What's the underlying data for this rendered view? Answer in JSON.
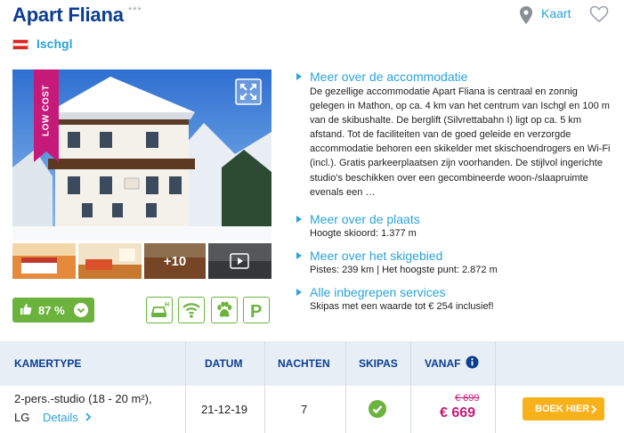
{
  "header": {
    "title": "Apart Fliana",
    "stars": "***",
    "location": "Ischgl",
    "map_label": "Kaart"
  },
  "gallery": {
    "badge": "LOW COST",
    "more_photos": "+10"
  },
  "rating": {
    "value": "87 %",
    "color": "#6cb33e"
  },
  "facility_icons": [
    "parking-garage-icon",
    "wifi-icon",
    "pets-icon",
    "parking-icon"
  ],
  "info": {
    "accommodation": {
      "heading": "Meer over de accommodatie",
      "text": "De gezellige accommodatie Apart Fliana is centraal en zonnig gelegen in Mathon, op ca. 4 km van het centrum van Ischgl en 100 m van de skibushalte. De berglift (Silvrettabahn I) ligt op ca. 5 km afstand. Tot de faciliteiten van de goed geleide en verzorgde accommodatie behoren een skikelder met skischoendrogers en Wi-Fi (incl.). Gratis parkeerplaatsen zijn voorhanden. De stijlvol ingerichte studio's beschikken over een gecombineerde woon-/slaapruimte evenals een …"
    },
    "place": {
      "heading": "Meer over de plaats",
      "text": "Hoogte skioord: 1.377 m"
    },
    "ski_area": {
      "heading": "Meer over het skigebied",
      "text": "Pistes: 239 km | Het hoogste punt: 2.872 m"
    },
    "services": {
      "heading": "Alle inbegrepen services",
      "text": "Skipas met een waarde tot € 254 inclusief!"
    }
  },
  "table": {
    "headers": {
      "room": "KAMERTYPE",
      "date": "DATUM",
      "nights": "NACHTEN",
      "skipass": "SKIPAS",
      "from": "VANAF"
    },
    "row": {
      "room_line1": "2-pers.-studio (18 - 20 m²),",
      "room_line2": "LG",
      "details": "Details",
      "date": "21-12-19",
      "nights": "7",
      "old_price": "€ 699",
      "price": "€ 669",
      "book": "BOEK HIER"
    }
  },
  "colors": {
    "brand_blue": "#0b3d91",
    "link_blue": "#2ba3d9",
    "price_magenta": "#c51a79",
    "button_orange": "#f7b21b",
    "green": "#6cb33e"
  }
}
